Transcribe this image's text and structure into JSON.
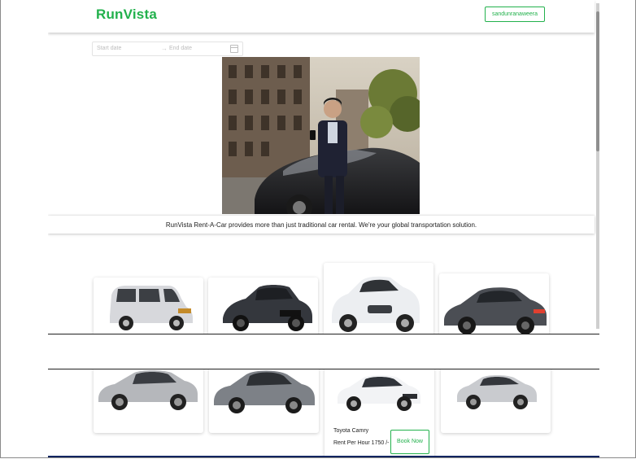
{
  "navbar": {
    "brand": "RunVista",
    "user_button": "sandunranaweera"
  },
  "date_range": {
    "start_placeholder": "Start date",
    "end_placeholder": "End date",
    "separator": "→"
  },
  "hero": {
    "image": "man-with-phone-leaning-on-car",
    "tagline": "RunVista Rent-A-Car provides more than just traditional car rental. We're your global transportation solution."
  },
  "cars": [
    {
      "image": "silver-hatchback-wagon"
    },
    {
      "image": "dark-grey-sports-sedan"
    },
    {
      "image": "white-hatchback"
    },
    {
      "image": "dark-grey-sedan"
    },
    {
      "image": "silver-sedan"
    },
    {
      "image": "grey-compact-sedan"
    },
    {
      "image": "white-toyota-camry",
      "name": "Toyota Camry",
      "rent": "Rent Per Hour 1750 /-",
      "book_label": "Book Now"
    },
    {
      "image": "silver-lexus-sedan"
    }
  ],
  "colors": {
    "brand_green": "#22b14c",
    "footer_navy": "#0e2460"
  }
}
